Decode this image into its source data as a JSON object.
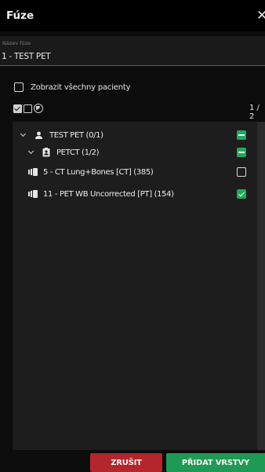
{
  "header": {
    "title": "Fúze",
    "close_label": "✕"
  },
  "name_field": {
    "label": "Název fúze",
    "value": "1 - TEST PET"
  },
  "show_all": {
    "label": "Zobrazit všechny pacienty",
    "checked": false
  },
  "selection": {
    "counter": "1 / 2"
  },
  "tree": {
    "patient": {
      "label": "TEST PET (0/1)",
      "state": "partial",
      "icon": "person-icon"
    },
    "study": {
      "label": "PETCT (1/2)",
      "state": "partial",
      "icon": "id-badge-icon"
    },
    "series": [
      {
        "label": "5 - CT Lung+Bones [CT] (385)",
        "state": "unchecked",
        "icon": "series-stack-icon"
      },
      {
        "label": "11 - PET WB Uncorrected [PT] (154)",
        "state": "checked",
        "icon": "series-stack-icon"
      }
    ]
  },
  "footer": {
    "cancel_label": "ZRUŠIT",
    "add_label": "PŘIDAT VRSTVY"
  },
  "colors": {
    "accent_green": "#1f9a55",
    "danger_red": "#b3262b",
    "checkbox_green": "#1faa5b"
  }
}
